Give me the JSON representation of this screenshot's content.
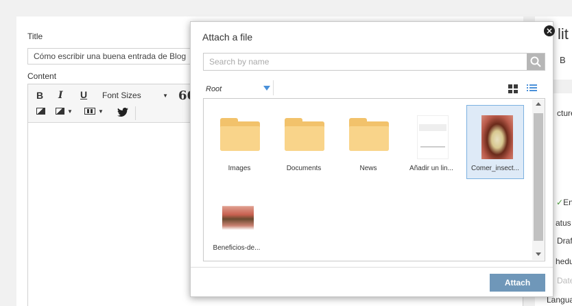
{
  "editor": {
    "title_label": "Title",
    "title_value": "Cómo escribir una buena entrada de Blog",
    "content_label": "Content",
    "toolbar": {
      "bold": "B",
      "italic": "I",
      "underline": "U",
      "font_sizes": "Font Sizes",
      "quote": "66"
    }
  },
  "sidebar": {
    "header": "lit",
    "btn": "B",
    "picture_label": "cture",
    "enable_label": "En",
    "status_label": "atus",
    "status_value": "Draf",
    "schedule_label": "hedu",
    "date_placeholder": "Date",
    "language_label": "Langua"
  },
  "modal": {
    "title": "Attach a file",
    "close_glyph": "×",
    "search_placeholder": "Search by name",
    "folder_select": "Root",
    "items": [
      {
        "type": "folder",
        "label": "Images"
      },
      {
        "type": "folder",
        "label": "Documents"
      },
      {
        "type": "folder",
        "label": "News"
      },
      {
        "type": "image",
        "label": "Añadir un lin..."
      },
      {
        "type": "image",
        "label": "Comer_insect...",
        "selected": true
      },
      {
        "type": "image",
        "label": "Beneficios-de..."
      }
    ],
    "attach_label": "Attach"
  },
  "colors": {
    "accent": "#4a90d9",
    "attach_button": "#6f97b9",
    "folder": "#f9d48a",
    "selected_bg": "#deeaf7"
  }
}
